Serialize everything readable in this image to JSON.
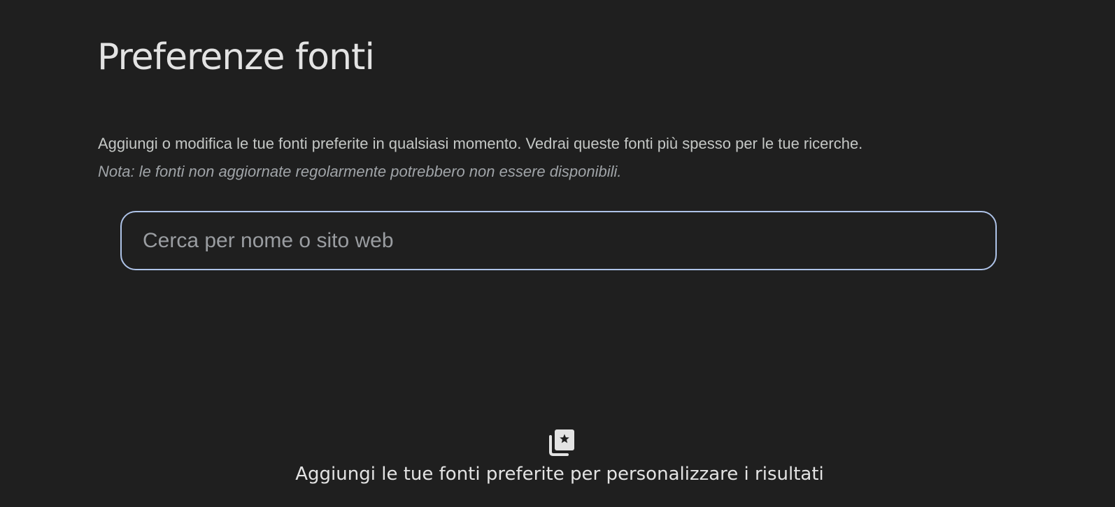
{
  "header": {
    "title": "Preferenze fonti"
  },
  "intro": {
    "description": "Aggiungi o modifica le tue fonti preferite in qualsiasi momento. Vedrai queste fonti più spesso per le tue ricerche.",
    "note": "Nota: le fonti non aggiornate regolarmente potrebbero non essere disponibili."
  },
  "search": {
    "placeholder": "Cerca per nome o sito web",
    "value": ""
  },
  "empty_state": {
    "icon": "star-collection-icon",
    "message": "Aggiungi le tue fonti preferite per personalizzare i risultati"
  },
  "colors": {
    "background": "#1f1f1f",
    "text_primary": "#e3e3e3",
    "search_border": "#aec3e8"
  }
}
